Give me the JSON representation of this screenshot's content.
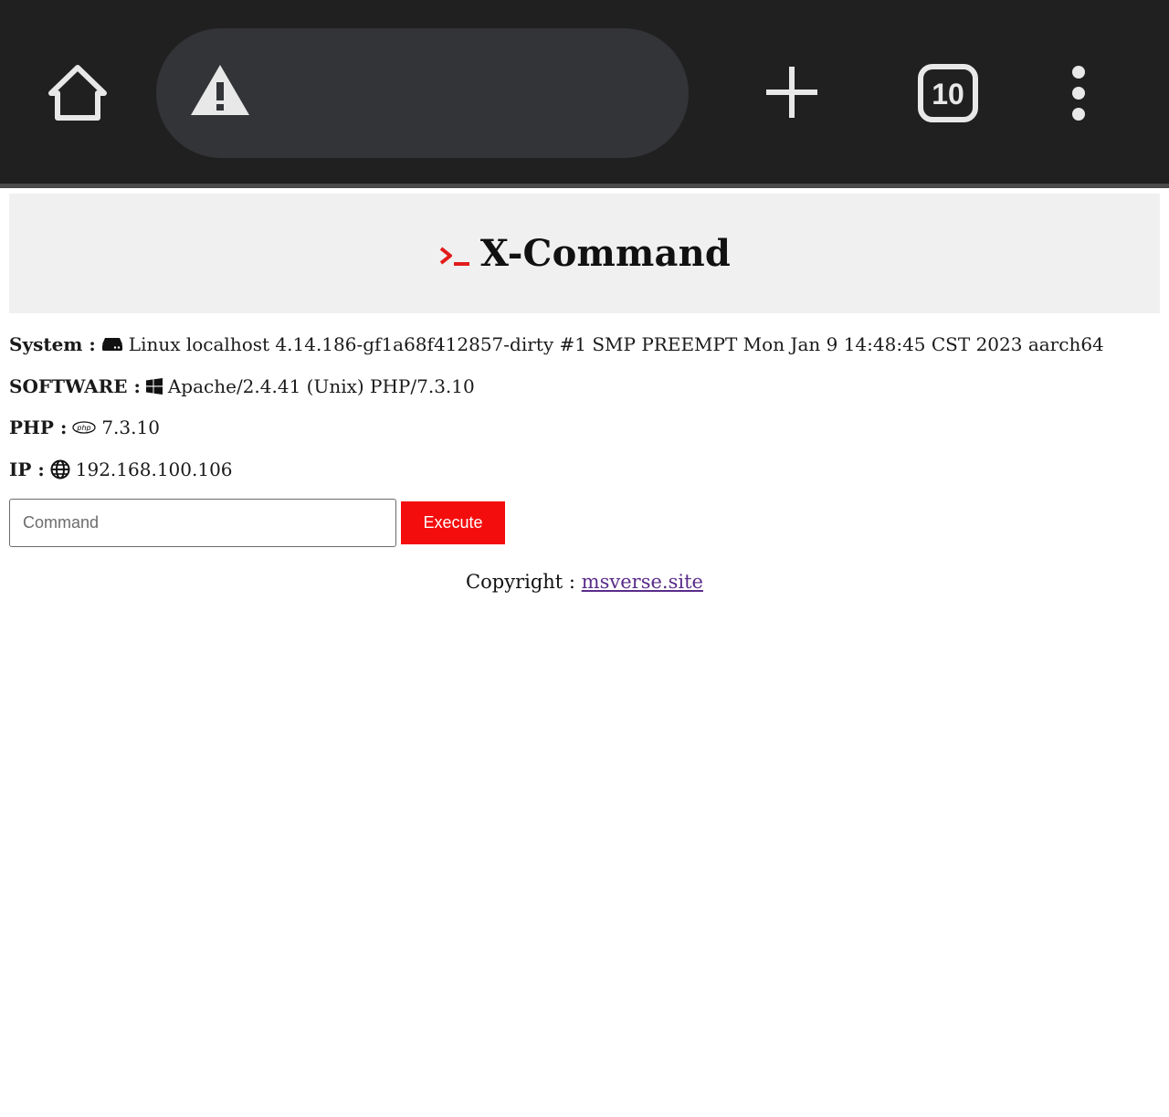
{
  "browser": {
    "tab_count": "10",
    "accent_colors": {
      "toolbar_bg": "#202020",
      "urlbar_bg": "#333437",
      "icon_fg": "#e8e8e8"
    },
    "icons": [
      "home-icon",
      "warning-icon",
      "plus-icon",
      "tab-count-icon",
      "kebab-menu-icon"
    ]
  },
  "header": {
    "title": "X-Command",
    "prompt_icon": "terminal-prompt-icon",
    "prompt_color": "#e21b1b",
    "bg": "#f0f0f0"
  },
  "info": {
    "system": {
      "label": "System :",
      "icon": "hdd-icon",
      "value": "Linux localhost 4.14.186-gf1a68f412857-dirty #1 SMP PREEMPT Mon Jan 9 14:48:45 CST 2023 aarch64"
    },
    "software": {
      "label": "SOFTWARE :",
      "icon": "windows-icon",
      "value": "Apache/2.4.41 (Unix) PHP/7.3.10"
    },
    "php": {
      "label": "PHP :",
      "icon": "php-icon",
      "value": "7.3.10"
    },
    "ip": {
      "label": "IP :",
      "icon": "globe-icon",
      "value": "192.168.100.106"
    }
  },
  "command": {
    "placeholder": "Command",
    "value": "",
    "execute_label": "Execute",
    "execute_color": "#f40d0d"
  },
  "footer": {
    "prefix": "Copyright :",
    "link_text": "msverse.site"
  }
}
